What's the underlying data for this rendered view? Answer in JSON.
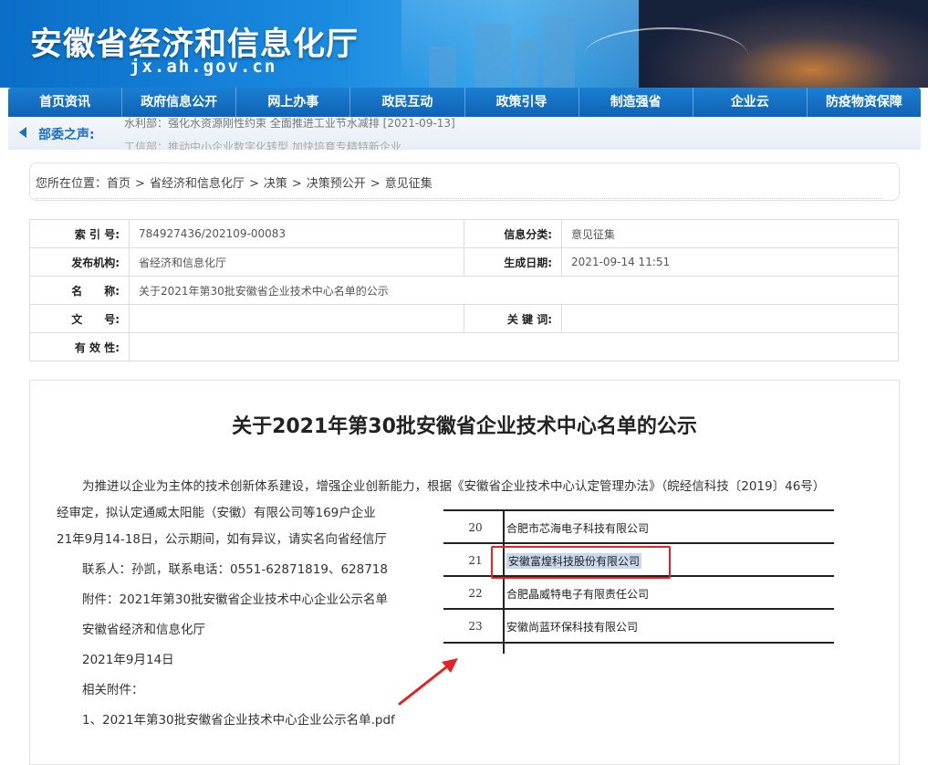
{
  "header": {
    "site_title": "安徽省经济和信息化厅",
    "site_domain": "jx.ah.gov.cn"
  },
  "nav": {
    "items": [
      "首页资讯",
      "政府信息公开",
      "网上办事",
      "政民互动",
      "政策引导",
      "制造强省",
      "企业云",
      "防疫物资保障"
    ]
  },
  "voice": {
    "label": "部委之声:",
    "news": "水利部：强化水资源刚性约束 全面推进工业节水减排 [2021-09-13]",
    "news_next": "工信部：推动中小企业数字化转型 加快培育专精特新企业"
  },
  "breadcrumb": {
    "prefix": "您所在位置：",
    "items": [
      "首页",
      "省经济和信息化厅",
      "决策",
      "决策预公开",
      "意见征集"
    ]
  },
  "info": {
    "index_label": "索 引 号:",
    "index_value": "784927436/202109-00083",
    "category_label": "信息分类:",
    "category_value": "意见征集",
    "publisher_label": "发布机构:",
    "publisher_value": "省经济和信息化厅",
    "date_label": "生成日期:",
    "date_value": "2021-09-14 11:51",
    "name_label": "名　　称:",
    "name_value": "关于2021年第30批安徽省企业技术中心名单的公示",
    "docno_label": "文　　号:",
    "docno_value": "",
    "keyword_label": "关 键 词:",
    "keyword_value": "",
    "validity_label": "有 效 性:",
    "validity_value": ""
  },
  "article": {
    "title": "关于2021年第30批安徽省企业技术中心名单的公示",
    "p1": "为推进以企业为主体的技术创新体系建设，增强企业创新能力，根据《安徽省企业技术中心认定管理办法》（皖经信科技〔2019〕46号）",
    "p2": "经审定，拟认定通威太阳能（安徽）有限公司等169户企业",
    "p3": "21年9月14-18日，公示期间，如有异议，请实名向省经信厅",
    "contact": "联系人：孙凯，联系电话：0551-62871819、628718",
    "attachment": "附件：2021年第30批安徽省企业技术中心企业公示名单",
    "org": "安徽省经济和信息化厅",
    "date": "2021年9月14日",
    "related": "相关附件：",
    "file": "1、2021年第30批安徽省企业技术中心企业公示名单.pdf"
  },
  "overlay": {
    "rows": [
      {
        "no": "20",
        "company": "合肥市芯海电子科技有限公司"
      },
      {
        "no": "21",
        "company": "安徽富煌科技股份有限公司"
      },
      {
        "no": "22",
        "company": "合肥晶威特电子有限责任公司"
      },
      {
        "no": "23",
        "company": "安徽尚蓝环保科技有限公司"
      }
    ],
    "highlight_color": "#e42424",
    "arrow_color": "#e42424"
  }
}
